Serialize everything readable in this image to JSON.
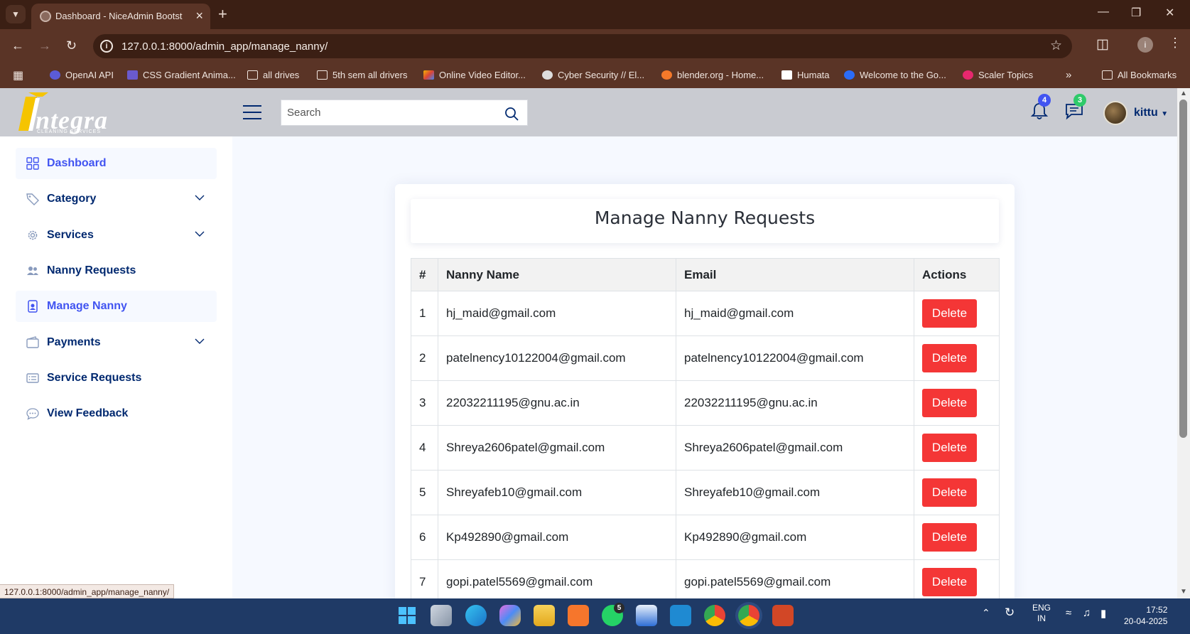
{
  "browser": {
    "tab_title": "Dashboard - NiceAdmin Bootst",
    "url": "127.0.0.1:8000/admin_app/manage_nanny/",
    "bookmarks": [
      "OpenAI API",
      "CSS Gradient Anima...",
      "all drives",
      "5th sem all drivers",
      "Online Video Editor...",
      "Cyber Security // El...",
      "blender.org - Home...",
      "Humata",
      "Welcome to the Go...",
      "Scaler Topics"
    ],
    "all_bookmarks": "All Bookmarks",
    "status_url": "127.0.0.1:8000/admin_app/manage_nanny/",
    "profile_initial": "i"
  },
  "header": {
    "logo_text": "ntegra",
    "logo_sub": "CLEANING   SERVICES",
    "search_placeholder": "Search",
    "notifications_count": "4",
    "messages_count": "3",
    "user_name": "kittu",
    "colors": {
      "bell_badge": "#4154f1",
      "msg_badge": "#2eca6a"
    }
  },
  "sidebar": {
    "items": [
      {
        "label": "Dashboard",
        "icon": "grid-icon"
      },
      {
        "label": "Category",
        "icon": "tag-icon"
      },
      {
        "label": "Services",
        "icon": "gear-icon"
      },
      {
        "label": "Nanny Requests",
        "icon": "people-icon"
      },
      {
        "label": "Manage Nanny",
        "icon": "person-badge-icon"
      },
      {
        "label": "Payments",
        "icon": "wallet-icon"
      },
      {
        "label": "Service Requests",
        "icon": "card-list-icon"
      },
      {
        "label": "View Feedback",
        "icon": "chat-dots-icon"
      }
    ]
  },
  "main": {
    "title": "Manage Nanny Requests",
    "columns": [
      "#",
      "Nanny Name",
      "Email",
      "Actions"
    ],
    "delete_label": "Delete",
    "rows": [
      {
        "num": "1",
        "name": "hj_maid@gmail.com",
        "email": "hj_maid@gmail.com"
      },
      {
        "num": "2",
        "name": "patelnency10122004@gmail.com",
        "email": "patelnency10122004@gmail.com"
      },
      {
        "num": "3",
        "name": "22032211195@gnu.ac.in",
        "email": "22032211195@gnu.ac.in"
      },
      {
        "num": "4",
        "name": "Shreya2606patel@gmail.com",
        "email": "Shreya2606patel@gmail.com"
      },
      {
        "num": "5",
        "name": "Shreyafeb10@gmail.com",
        "email": "Shreyafeb10@gmail.com"
      },
      {
        "num": "6",
        "name": "Kp492890@gmail.com",
        "email": "Kp492890@gmail.com"
      },
      {
        "num": "7",
        "name": "gopi.patel5569@gmail.com",
        "email": "gopi.patel5569@gmail.com"
      }
    ]
  },
  "taskbar": {
    "whatsapp_badge": "5",
    "lang_line1": "ENG",
    "lang_line2": "IN",
    "time": "17:52",
    "date": "20-04-2025"
  }
}
